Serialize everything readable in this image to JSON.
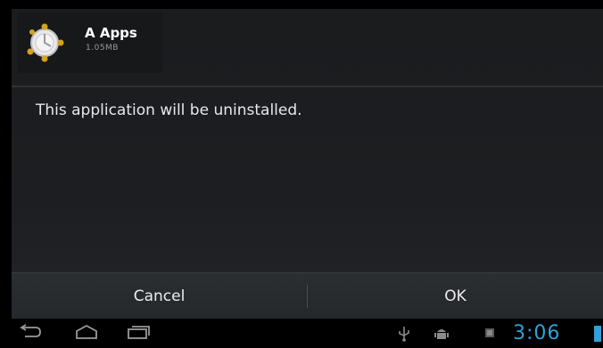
{
  "dialog": {
    "app_name": "A Apps",
    "app_size": "1.05MB",
    "message": "This application will be uninstalled.",
    "cancel_label": "Cancel",
    "ok_label": "OK"
  },
  "status_bar": {
    "time": "3:06",
    "accent_color": "#2fa0d8",
    "icons": [
      "usb-icon",
      "android-debug-icon",
      "notification-icon",
      "battery-icon"
    ]
  },
  "nav_bar": {
    "icons": [
      "back-icon",
      "home-icon",
      "recent-apps-icon"
    ]
  }
}
